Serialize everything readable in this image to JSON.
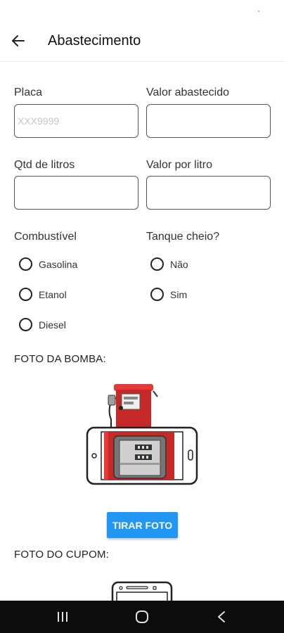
{
  "app_bar": {
    "title": "Abastecimento",
    "back_icon": "arrow-left-icon"
  },
  "form": {
    "placa": {
      "label": "Placa",
      "value": "",
      "placeholder": "XXX9999"
    },
    "valor_abastecido": {
      "label": "Valor abastecido",
      "value": "",
      "placeholder": ""
    },
    "qtd_litros": {
      "label": "Qtd de litros",
      "value": "",
      "placeholder": ""
    },
    "valor_por_litro": {
      "label": "Valor por litro",
      "value": "",
      "placeholder": ""
    },
    "combustivel": {
      "label": "Combustível",
      "options": [
        "Gasolina",
        "Etanol",
        "Diesel"
      ],
      "selected": null
    },
    "tanque_cheio": {
      "label": "Tanque cheio?",
      "options": [
        "Não",
        "Sim"
      ],
      "selected": null
    }
  },
  "photo_bomba": {
    "label": "FOTO DA BOMBA:",
    "button_label": "TIRAR FOTO",
    "illustration": "fuel-pump-phone-illustration"
  },
  "photo_cupom": {
    "label": "FOTO DO CUPOM:",
    "illustration": "phone-receipt-illustration"
  },
  "colors": {
    "accent": "#2196f3",
    "pump_red": "#d32f2f",
    "nav_bar": "#0c0c0c"
  },
  "nav": {
    "recents_icon": "recents-icon",
    "home_icon": "home-icon",
    "back_icon": "back-chevron-icon"
  }
}
